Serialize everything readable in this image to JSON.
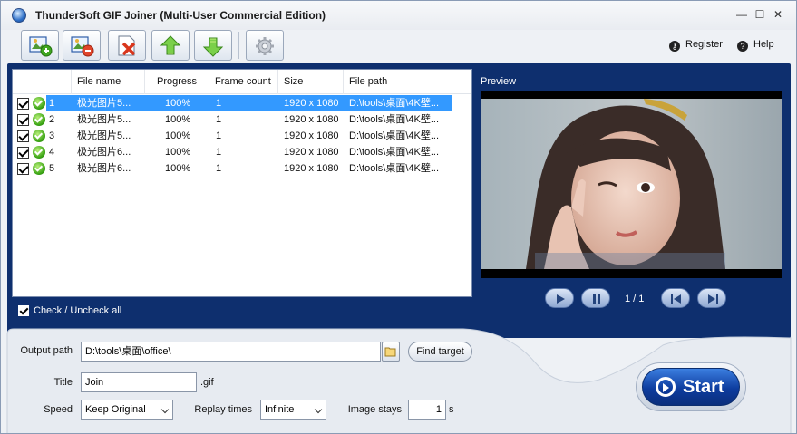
{
  "window": {
    "title": "ThunderSoft GIF Joiner (Multi-User Commercial Edition)",
    "controls": [
      "—",
      "☐",
      "✕"
    ]
  },
  "toolbar": {
    "buttons": [
      {
        "icon": "add-image-icon"
      },
      {
        "icon": "remove-image-icon"
      },
      {
        "icon": "clear-list-icon"
      },
      {
        "icon": "move-up-icon"
      },
      {
        "icon": "move-down-icon"
      },
      {
        "icon": "settings-icon"
      }
    ],
    "register_label": "Register",
    "help_label": "Help"
  },
  "file_list": {
    "columns": [
      "File name",
      "Progress",
      "Frame count",
      "Size",
      "File path"
    ],
    "rows": [
      {
        "index": "1",
        "name": "极光图片5...",
        "progress": "100%",
        "frames": "1",
        "size": "1920 x 1080",
        "path": "D:\\tools\\桌面\\4K壁..."
      },
      {
        "index": "2",
        "name": "极光图片5...",
        "progress": "100%",
        "frames": "1",
        "size": "1920 x 1080",
        "path": "D:\\tools\\桌面\\4K壁..."
      },
      {
        "index": "3",
        "name": "极光图片5...",
        "progress": "100%",
        "frames": "1",
        "size": "1920 x 1080",
        "path": "D:\\tools\\桌面\\4K壁..."
      },
      {
        "index": "4",
        "name": "极光图片6...",
        "progress": "100%",
        "frames": "1",
        "size": "1920 x 1080",
        "path": "D:\\tools\\桌面\\4K壁..."
      },
      {
        "index": "5",
        "name": "极光图片6...",
        "progress": "100%",
        "frames": "1",
        "size": "1920 x 1080",
        "path": "D:\\tools\\桌面\\4K壁..."
      }
    ],
    "check_all_label": "Check / Uncheck all"
  },
  "preview": {
    "label": "Preview",
    "page": "1 / 1"
  },
  "output": {
    "path_label": "Output path",
    "path_value": "D:\\tools\\桌面\\office\\",
    "find_target_label": "Find target",
    "title_label": "Title",
    "title_value": "Join",
    "title_ext": ".gif",
    "speed_label": "Speed",
    "speed_value": "Keep Original",
    "replay_label": "Replay times",
    "replay_value": "Infinite",
    "image_stays_label": "Image stays",
    "image_stays_value": "1",
    "image_stays_unit": "s"
  },
  "start_label": "Start",
  "colors": {
    "panel_blue": "#0e2f6e",
    "selection": "#3399ff",
    "start_blue": "#1b56c4"
  }
}
